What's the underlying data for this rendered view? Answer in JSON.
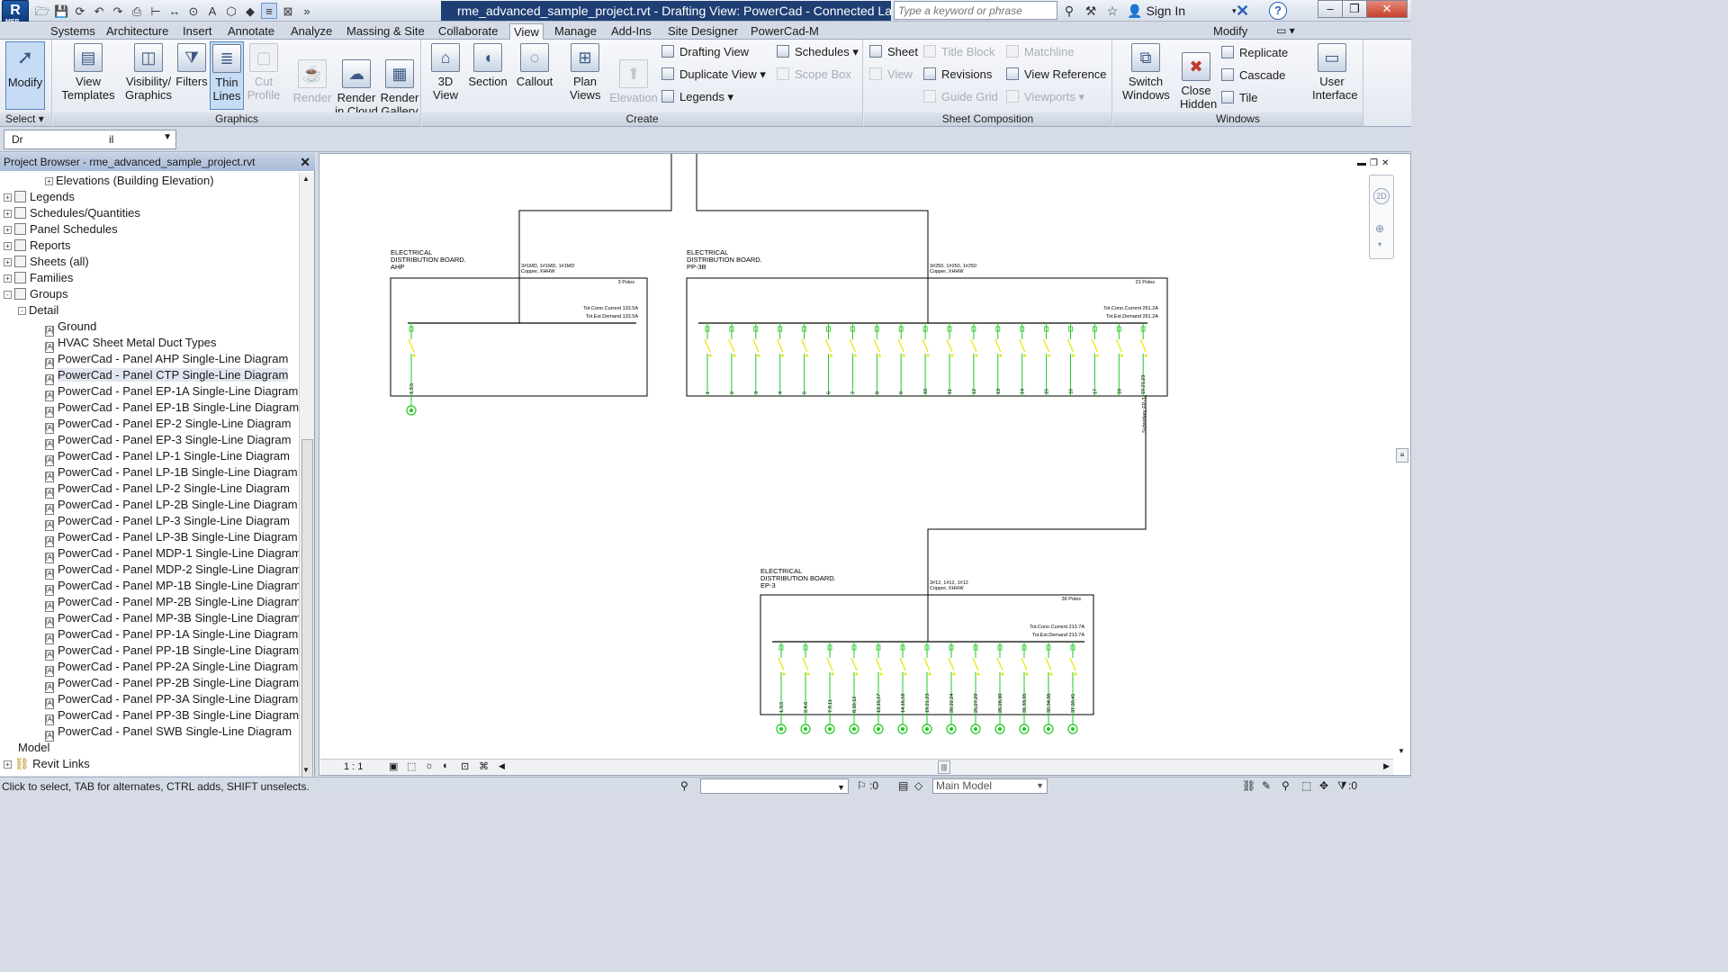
{
  "window": {
    "title": "rme_advanced_sample_project.rvt - Drafting View: PowerCad - Connected Layout of S...",
    "search_placeholder": "Type a keyword or phrase",
    "signin_label": "Sign In",
    "logo_label": "MEP"
  },
  "ribbon_tabs": [
    "Systems",
    "Architecture",
    "Insert",
    "Annotate",
    "Analyze",
    "Massing & Site",
    "Collaborate",
    "View",
    "Manage",
    "Add-Ins",
    "Site Designer",
    "PowerCad-M"
  ],
  "active_tab": "View",
  "context_tab": "Modify",
  "ribbon": {
    "select": {
      "modify": "Modify",
      "title": "Select"
    },
    "graphics": {
      "title": "Graphics",
      "view_templates": "View Templates",
      "visibility": "Visibility/ Graphics",
      "filters": "Filters",
      "thin_lines": "Thin Lines",
      "cut_profile": "Cut Profile",
      "render": "Render",
      "render_cloud": "Render in Cloud",
      "render_gallery": "Render Gallery"
    },
    "create": {
      "title": "Create",
      "view_3d": "3D View",
      "section": "Section",
      "callout": "Callout",
      "plan_views": "Plan Views",
      "elevation": "Elevation",
      "drafting_view": "Drafting View",
      "duplicate_view": "Duplicate View",
      "legends": "Legends",
      "schedules": "Schedules",
      "scope_box": "Scope Box"
    },
    "sheet": {
      "title": "Sheet Composition",
      "sheet": "Sheet",
      "view": "View",
      "title_block": "Title Block",
      "revisions": "Revisions",
      "guide_grid": "Guide Grid",
      "matchline": "Matchline",
      "view_reference": "View Reference",
      "viewports": "Viewports"
    },
    "windows": {
      "title": "Windows",
      "switch_windows": "Switch Windows",
      "close_hidden": "Close Hidden",
      "replicate": "Replicate",
      "cascade": "Cascade",
      "tile": "Tile",
      "user_interface": "User Interface"
    }
  },
  "options_bar": {
    "value": "Dr",
    "value2": "il"
  },
  "project_browser": {
    "title": "Project Browser - rme_advanced_sample_project.rvt",
    "items": [
      {
        "label": "Elevations (Building Elevation)",
        "level": 3,
        "expand": "+"
      },
      {
        "label": "Legends",
        "level": 0,
        "expand": "+",
        "icon": "file"
      },
      {
        "label": "Schedules/Quantities",
        "level": 0,
        "expand": "+",
        "icon": "file"
      },
      {
        "label": "Panel Schedules",
        "level": 0,
        "expand": "+",
        "icon": "file"
      },
      {
        "label": "Reports",
        "level": 0,
        "expand": "+",
        "icon": "file"
      },
      {
        "label": "Sheets (all)",
        "level": 0,
        "expand": "+",
        "icon": "file"
      },
      {
        "label": "Families",
        "level": 0,
        "expand": "+",
        "icon": "file"
      },
      {
        "label": "Groups",
        "level": 0,
        "expand": "-",
        "icon": "file"
      },
      {
        "label": "Detail",
        "level": 1,
        "expand": "-"
      },
      {
        "label": "Ground",
        "level": 2,
        "icon": "group"
      },
      {
        "label": "HVAC Sheet Metal Duct Types",
        "level": 2,
        "icon": "group"
      },
      {
        "label": "PowerCad - Panel AHP Single-Line Diagram",
        "level": 2,
        "icon": "group"
      },
      {
        "label": "PowerCad - Panel CTP Single-Line Diagram",
        "level": 2,
        "icon": "group",
        "selected": true
      },
      {
        "label": "PowerCad - Panel EP-1A Single-Line Diagram",
        "level": 2,
        "icon": "group"
      },
      {
        "label": "PowerCad - Panel EP-1B Single-Line Diagram",
        "level": 2,
        "icon": "group"
      },
      {
        "label": "PowerCad - Panel EP-2 Single-Line Diagram",
        "level": 2,
        "icon": "group"
      },
      {
        "label": "PowerCad - Panel EP-3 Single-Line Diagram",
        "level": 2,
        "icon": "group"
      },
      {
        "label": "PowerCad - Panel LP-1 Single-Line Diagram",
        "level": 2,
        "icon": "group"
      },
      {
        "label": "PowerCad - Panel LP-1B Single-Line Diagram",
        "level": 2,
        "icon": "group"
      },
      {
        "label": "PowerCad - Panel LP-2 Single-Line Diagram",
        "level": 2,
        "icon": "group"
      },
      {
        "label": "PowerCad - Panel LP-2B Single-Line Diagram",
        "level": 2,
        "icon": "group"
      },
      {
        "label": "PowerCad - Panel LP-3 Single-Line Diagram",
        "level": 2,
        "icon": "group"
      },
      {
        "label": "PowerCad - Panel LP-3B Single-Line Diagram",
        "level": 2,
        "icon": "group"
      },
      {
        "label": "PowerCad - Panel MDP-1 Single-Line Diagram",
        "level": 2,
        "icon": "group"
      },
      {
        "label": "PowerCad - Panel MDP-2 Single-Line Diagram",
        "level": 2,
        "icon": "group"
      },
      {
        "label": "PowerCad - Panel MP-1B Single-Line Diagram",
        "level": 2,
        "icon": "group"
      },
      {
        "label": "PowerCad - Panel MP-2B Single-Line Diagram",
        "level": 2,
        "icon": "group"
      },
      {
        "label": "PowerCad - Panel MP-3B Single-Line Diagram",
        "level": 2,
        "icon": "group"
      },
      {
        "label": "PowerCad - Panel PP-1A Single-Line Diagram",
        "level": 2,
        "icon": "group"
      },
      {
        "label": "PowerCad - Panel PP-1B Single-Line Diagram",
        "level": 2,
        "icon": "group"
      },
      {
        "label": "PowerCad - Panel PP-2A Single-Line Diagram",
        "level": 2,
        "icon": "group"
      },
      {
        "label": "PowerCad - Panel PP-2B Single-Line Diagram",
        "level": 2,
        "icon": "group"
      },
      {
        "label": "PowerCad - Panel PP-3A Single-Line Diagram",
        "level": 2,
        "icon": "group"
      },
      {
        "label": "PowerCad - Panel PP-3B Single-Line Diagram",
        "level": 2,
        "icon": "group"
      },
      {
        "label": "PowerCad - Panel SWB Single-Line Diagram",
        "level": 2,
        "icon": "group"
      },
      {
        "label": "Model",
        "level": 1
      },
      {
        "label": "Revit Links",
        "level": 0,
        "expand": "+",
        "icon": "link"
      }
    ]
  },
  "drawing": {
    "boards": [
      {
        "title1": "ELECTRICAL",
        "title2": "DISTRIBUTION BOARD.",
        "name": "AHP",
        "feeder1": "3#1MD, 1#1MD, 1#1MD",
        "feeder2": "Copper, XHHW",
        "poles": "3 Poles",
        "conn": "Tot.Conn.Current 133.5A",
        "demand": "Tot.Est.Demand 133.5A",
        "circuits": [
          "1,3,5"
        ]
      },
      {
        "title1": "ELECTRICAL",
        "title2": "DISTRIBUTION BOARD.",
        "name": "PP-3B",
        "feeder1": "3#250, 1#250, 1#250",
        "feeder2": "Copper, XHHW",
        "poles": "21 Poles",
        "conn": "Tot.Conn.Current 261.2A",
        "demand": "Tot.Est.Demand 261.2A",
        "circuits": [
          "1",
          "2",
          "3",
          "4",
          "5",
          "6",
          "7",
          "8",
          "9",
          "10",
          "11",
          "12",
          "13",
          "14",
          "15",
          "16",
          "17",
          "18",
          "19,21,23"
        ],
        "subsidiary": "Subsidiary EP-3"
      },
      {
        "title1": "ELECTRICAL",
        "title2": "DISTRIBUTION BOARD.",
        "name": "EP-3",
        "feeder1": "3#12, 1#12, 1#12",
        "feeder2": "Copper, XHHW",
        "poles": "39 Poles",
        "conn": "Tot.Conn.Current 213.7A",
        "demand": "Tot.Est.Demand 213.7A",
        "circuits": [
          "1,3,5",
          "2,4,6",
          "7,9,11",
          "8,10,12",
          "13,15,17",
          "14,16,18",
          "19,21,23",
          "20,22,24",
          "25,27,29",
          "26,28,30",
          "31,33,35",
          "32,34,36",
          "37,39,41"
        ]
      }
    ]
  },
  "viewbar": {
    "scale": "1 : 1"
  },
  "status": {
    "message": "Click to select, TAB for alternates, CTRL adds, SHIFT unselects.",
    "filter_count": ":0",
    "model": "Main Model",
    "filter_count2": ":0"
  }
}
